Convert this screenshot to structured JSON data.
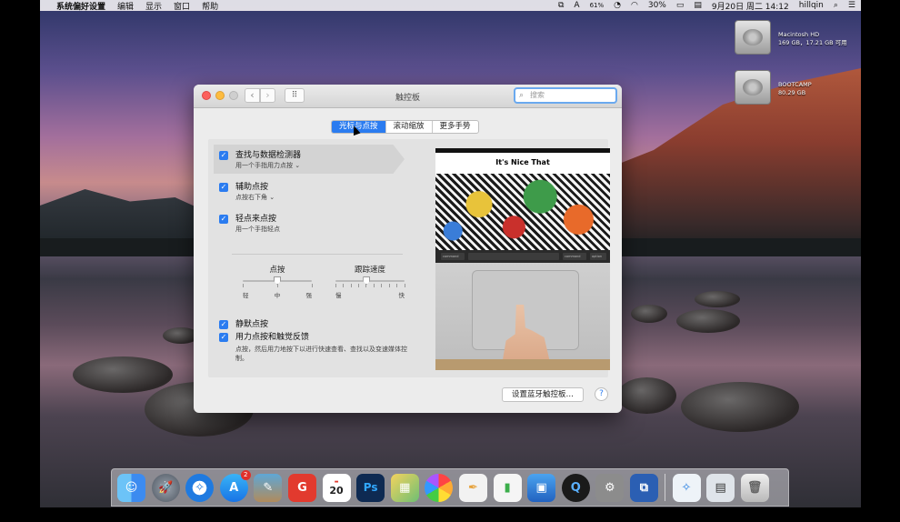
{
  "menubar": {
    "app": "系统偏好设置",
    "items": [
      "编辑",
      "显示",
      "窗口",
      "帮助"
    ],
    "status": {
      "battery_meter": "61%",
      "battery": "30%",
      "datetime": "9月20日 周二 14:12",
      "user": "hillqin"
    }
  },
  "desktop": {
    "disks": [
      {
        "name": "Macintosh HD",
        "info": "169 GB，17.21 GB 可用"
      },
      {
        "name": "BOOTCAMP",
        "info": "80.29 GB"
      }
    ]
  },
  "window": {
    "title": "触控板",
    "search_placeholder": "搜索",
    "tabs": [
      {
        "label": "光标与点按",
        "active": true
      },
      {
        "label": "滚动缩放",
        "active": false
      },
      {
        "label": "更多手势",
        "active": false
      }
    ],
    "options": [
      {
        "title": "查找与数据检测器",
        "subtitle": "用一个手指用力点按",
        "checked": true
      },
      {
        "title": "辅助点按",
        "subtitle": "点按右下角",
        "checked": true
      },
      {
        "title": "轻点来点按",
        "subtitle": "用一个手指轻点",
        "checked": true
      }
    ],
    "click_slider": {
      "label": "点按",
      "ticks": [
        "轻",
        "中",
        "强"
      ],
      "value_fraction": 0.5
    },
    "speed_slider": {
      "label": "跟踪速度",
      "ticks": [
        "慢",
        "快"
      ],
      "value_fraction": 0.45
    },
    "bottom_options": [
      {
        "title": "静默点按",
        "checked": true
      },
      {
        "title": "用力点按和触觉反馈",
        "checked": true,
        "description": "点按，然后用力地按下以进行快速查看、查找以及变速媒体控制。"
      }
    ],
    "preview": {
      "site_title": "It's Nice That"
    },
    "bluetooth_button": "设置蓝牙触控板…",
    "help": "?"
  },
  "dock": {
    "calendar_day": "20",
    "appstore_badge": "2",
    "colors": {
      "finder": "#3c8bf0",
      "safari": "#1f7ae0",
      "photoshop": "#0e2a52"
    }
  }
}
